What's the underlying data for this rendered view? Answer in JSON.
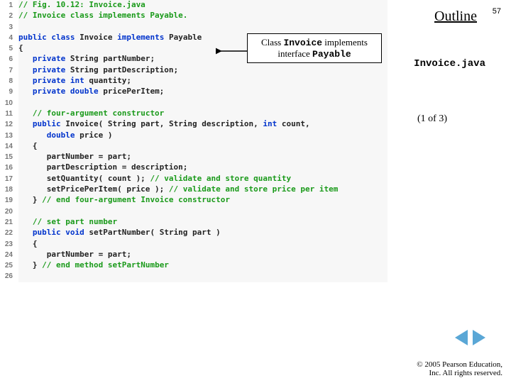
{
  "pageNumber": "57",
  "outlineTitle": "Outline",
  "fileLabel": "Invoice.java",
  "pageIndicator": "(1 of  3)",
  "copyright": {
    "line1": "© 2005 Pearson Education,",
    "line2": "Inc.  All rights reserved."
  },
  "callout": {
    "pre": "Class ",
    "class": "Invoice",
    "mid": " implements interface ",
    "iface": "Payable"
  },
  "code": [
    {
      "ln": "1",
      "seg": [
        {
          "c": "cmt",
          "t": "// Fig. 10.12: Invoice.java"
        }
      ]
    },
    {
      "ln": "2",
      "seg": [
        {
          "c": "cmt",
          "t": "// Invoice class implements Payable."
        }
      ]
    },
    {
      "ln": "3",
      "seg": []
    },
    {
      "ln": "4",
      "seg": [
        {
          "c": "kw",
          "t": "public class"
        },
        {
          "c": "pl",
          "t": " Invoice "
        },
        {
          "c": "kw",
          "t": "implements"
        },
        {
          "c": "pl",
          "t": " Payable"
        }
      ]
    },
    {
      "ln": "5",
      "seg": [
        {
          "c": "pl",
          "t": "{"
        }
      ]
    },
    {
      "ln": "6",
      "seg": [
        {
          "c": "pl",
          "t": "   "
        },
        {
          "c": "kw",
          "t": "private"
        },
        {
          "c": "pl",
          "t": " String partNumber;"
        }
      ]
    },
    {
      "ln": "7",
      "seg": [
        {
          "c": "pl",
          "t": "   "
        },
        {
          "c": "kw",
          "t": "private"
        },
        {
          "c": "pl",
          "t": " String partDescription;"
        }
      ]
    },
    {
      "ln": "8",
      "seg": [
        {
          "c": "pl",
          "t": "   "
        },
        {
          "c": "kw",
          "t": "private int"
        },
        {
          "c": "pl",
          "t": " quantity;"
        }
      ]
    },
    {
      "ln": "9",
      "seg": [
        {
          "c": "pl",
          "t": "   "
        },
        {
          "c": "kw",
          "t": "private double"
        },
        {
          "c": "pl",
          "t": " pricePerItem;"
        }
      ]
    },
    {
      "ln": "10",
      "seg": []
    },
    {
      "ln": "11",
      "seg": [
        {
          "c": "pl",
          "t": "   "
        },
        {
          "c": "cmt",
          "t": "// four-argument constructor"
        }
      ]
    },
    {
      "ln": "12",
      "seg": [
        {
          "c": "pl",
          "t": "   "
        },
        {
          "c": "kw",
          "t": "public"
        },
        {
          "c": "pl",
          "t": " Invoice( String part, String description, "
        },
        {
          "c": "kw",
          "t": "int"
        },
        {
          "c": "pl",
          "t": " count,"
        }
      ]
    },
    {
      "ln": "13",
      "seg": [
        {
          "c": "pl",
          "t": "      "
        },
        {
          "c": "kw",
          "t": "double"
        },
        {
          "c": "pl",
          "t": " price )"
        }
      ]
    },
    {
      "ln": "14",
      "seg": [
        {
          "c": "pl",
          "t": "   {"
        }
      ]
    },
    {
      "ln": "15",
      "seg": [
        {
          "c": "pl",
          "t": "      partNumber = part;"
        }
      ]
    },
    {
      "ln": "16",
      "seg": [
        {
          "c": "pl",
          "t": "      partDescription = description;"
        }
      ]
    },
    {
      "ln": "17",
      "seg": [
        {
          "c": "pl",
          "t": "      setQuantity( count ); "
        },
        {
          "c": "cmt",
          "t": "// validate and store quantity"
        }
      ]
    },
    {
      "ln": "18",
      "seg": [
        {
          "c": "pl",
          "t": "      setPricePerItem( price ); "
        },
        {
          "c": "cmt",
          "t": "// validate and store price per item"
        }
      ]
    },
    {
      "ln": "19",
      "seg": [
        {
          "c": "pl",
          "t": "   } "
        },
        {
          "c": "cmt",
          "t": "// end four-argument Invoice constructor"
        }
      ]
    },
    {
      "ln": "20",
      "seg": []
    },
    {
      "ln": "21",
      "seg": [
        {
          "c": "pl",
          "t": "   "
        },
        {
          "c": "cmt",
          "t": "// set part number"
        }
      ]
    },
    {
      "ln": "22",
      "seg": [
        {
          "c": "pl",
          "t": "   "
        },
        {
          "c": "kw",
          "t": "public void"
        },
        {
          "c": "pl",
          "t": " setPartNumber( String part )"
        }
      ]
    },
    {
      "ln": "23",
      "seg": [
        {
          "c": "pl",
          "t": "   {"
        }
      ]
    },
    {
      "ln": "24",
      "seg": [
        {
          "c": "pl",
          "t": "      partNumber = part;"
        }
      ]
    },
    {
      "ln": "25",
      "seg": [
        {
          "c": "pl",
          "t": "   } "
        },
        {
          "c": "cmt",
          "t": "// end method setPartNumber"
        }
      ]
    },
    {
      "ln": "26",
      "seg": []
    }
  ]
}
